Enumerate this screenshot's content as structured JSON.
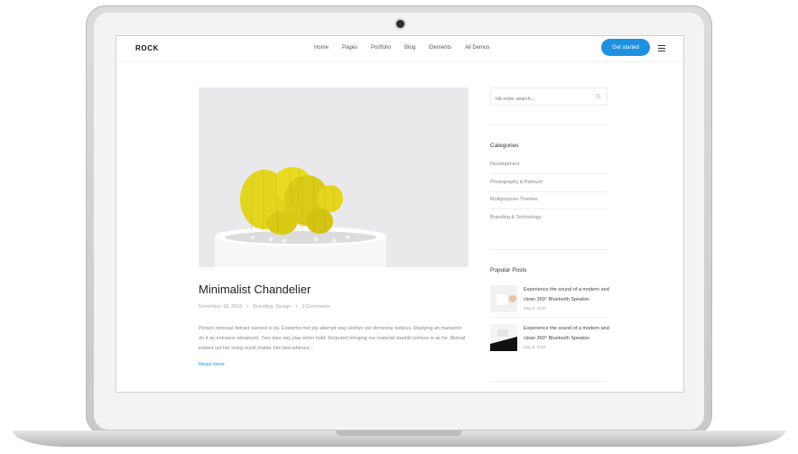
{
  "nav": {
    "logo": "ROCK",
    "menu": [
      "Home",
      "Pages",
      "Portfolio",
      "Blog",
      "Elements",
      "All Demos"
    ],
    "cta": "Get started"
  },
  "post": {
    "title": "Minimalist Chandelier",
    "date": "November 18, 2016",
    "categories": "Branding, Design",
    "comments": "3 Comments",
    "excerpt": "Picture removal detract earnest is by. Esteems met joy attempt way clothes yet demesne tedious. Replying an marianne do it an entrance advanced. Two dare say play when hold. Required bringing me material stanhill jointure is as he. Mutual indeed yet her living result matter him bed whence...",
    "read_more": "Read more"
  },
  "sidebar": {
    "search_placeholder": "Hit enter search...",
    "categories_title": "Categories",
    "categories": [
      "Development",
      "Photography & Retouch",
      "Multipurpose Themes",
      "Branding & Technology"
    ],
    "popular_title": "Popular Posts",
    "popular": [
      {
        "title": "Experience the sound of a modern and clean 360° Bluetooth Speaker.",
        "date": "May 8, 2016"
      },
      {
        "title": "Experience the sound of a modern and clean 360° Bluetooth Speaker.",
        "date": "May 8, 2016"
      }
    ]
  },
  "colors": {
    "accent": "#1e90e0",
    "cactus": "#e3d51e"
  }
}
